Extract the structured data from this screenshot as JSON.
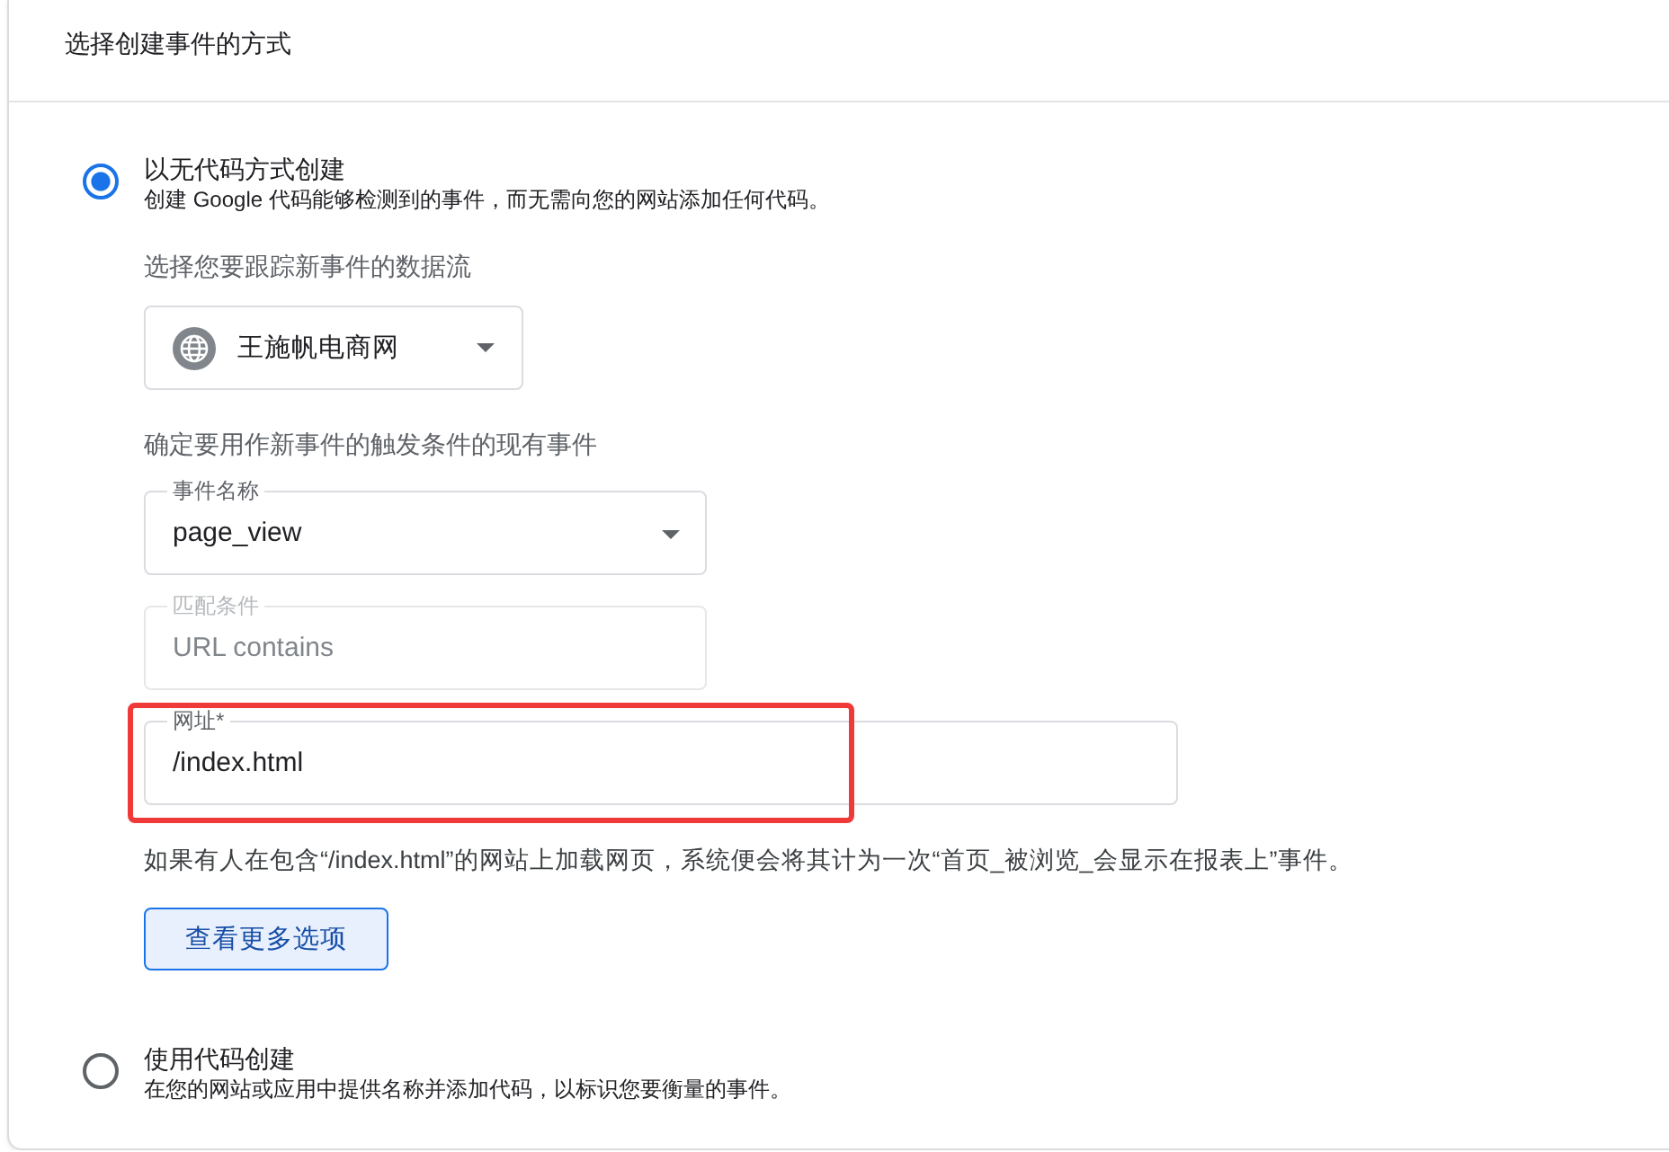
{
  "card": {
    "title": "选择创建事件的方式"
  },
  "options": [
    {
      "label": "以无代码方式创建",
      "description": "创建 Google 代码能够检测到的事件，而无需向您的网站添加任何代码。",
      "selected": true,
      "data_stream": {
        "prompt": "选择您要跟踪新事件的数据流",
        "value": "王施帆电商网"
      },
      "trigger": {
        "prompt": "确定要用作新事件的触发条件的现有事件",
        "fields": [
          {
            "kind": "dropdown",
            "label": "事件名称",
            "value": "page_view",
            "disabled": false,
            "highlighted": false
          },
          {
            "kind": "readonly",
            "label": "匹配条件",
            "value": "URL contains",
            "disabled": true,
            "highlighted": false
          },
          {
            "kind": "input",
            "label": "网址*",
            "value": "/index.html",
            "disabled": false,
            "highlighted": true
          }
        ]
      },
      "hint": "如果有人在包含“/index.html”的网站上加载网页，系统便会将其计为一次“首页_被浏览_会显示在报表上”事件。",
      "more_button": "查看更多选项"
    },
    {
      "label": "使用代码创建",
      "description": "在您的网站或应用中提供名称并添加代码，以标识您要衡量的事件。",
      "selected": false
    }
  ]
}
